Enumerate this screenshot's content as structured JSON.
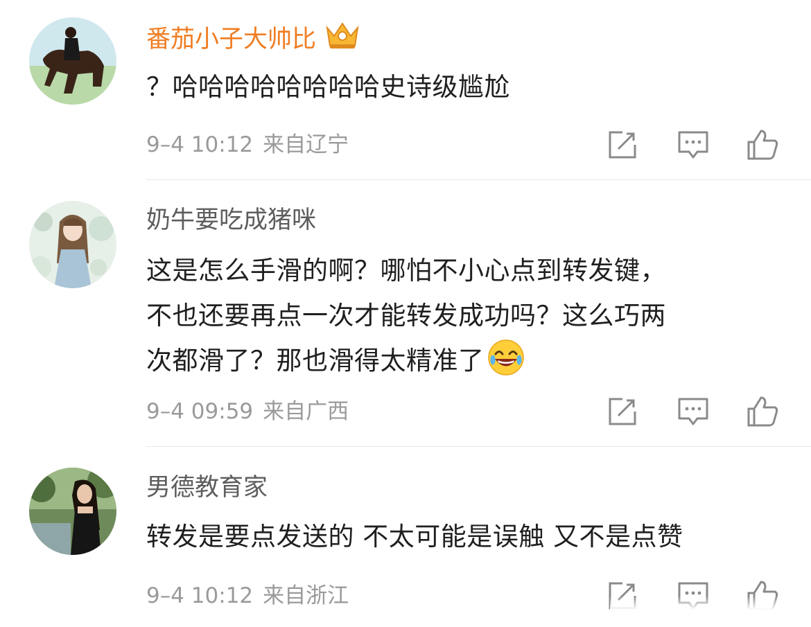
{
  "comments": [
    {
      "username": "番茄小子大帅比",
      "vip": true,
      "text": "？哈哈哈哈哈哈哈哈史诗级尴尬",
      "time": "9–4 10:12",
      "location": "来自辽宁"
    },
    {
      "username": "奶牛要吃成猪咪",
      "vip": false,
      "text_lines": [
        "这是怎么手滑的啊？哪怕不小心点到转发键，",
        "不也还要再点一次才能转发成功吗？这么巧两",
        "次都滑了？那也滑得太精准了"
      ],
      "emoji": "laughing-crying-emoji",
      "time": "9–4 09:59",
      "location": "来自广西"
    },
    {
      "username": "男德教育家",
      "vip": false,
      "text": "转发是要点发送的 不太可能是误触 又不是点赞",
      "time": "9–4 10:12",
      "location": "来自浙江"
    }
  ],
  "icons": {
    "repost": "repost-icon",
    "reply": "comment-icon",
    "like": "like-icon",
    "crown": "vip-crown-icon"
  },
  "colors": {
    "vip_name": "#f07d22",
    "name": "#5d5d5d",
    "text": "#1f1f1f",
    "meta": "#9a9a9a",
    "icon": "#8a8a8a"
  }
}
